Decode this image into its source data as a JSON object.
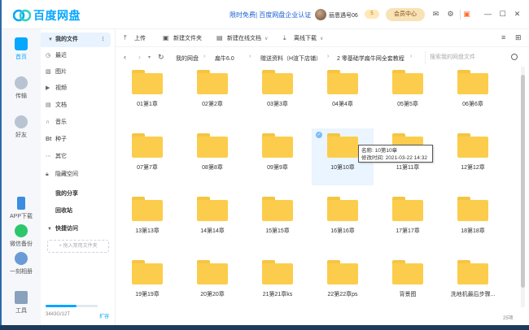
{
  "app": {
    "name": "百度网盘",
    "promo": "限时免费| 百度网盘企业认证",
    "username": "丽恩遇号06",
    "level_badge": "5",
    "vip_badge": "v",
    "member_center": "会员中心",
    "accent": "#06a7ff"
  },
  "nav": [
    {
      "label": "首页",
      "icon": "home-icon"
    },
    {
      "label": "传输",
      "icon": "transfer-icon"
    },
    {
      "label": "好友",
      "icon": "friends-icon"
    },
    {
      "label": "APP下载",
      "icon": "phone-icon"
    },
    {
      "label": "微信备份",
      "icon": "wechat-icon"
    },
    {
      "label": "一刻相册",
      "icon": "album-icon"
    },
    {
      "label": "工具",
      "icon": "tools-icon"
    }
  ],
  "sidebar": {
    "my_files": "我的文件",
    "items": [
      {
        "label": "最近",
        "icon": "clock-icon"
      },
      {
        "label": "图片",
        "icon": "image-icon"
      },
      {
        "label": "视频",
        "icon": "video-icon"
      },
      {
        "label": "文档",
        "icon": "document-icon"
      },
      {
        "label": "音乐",
        "icon": "headphones-icon"
      },
      {
        "label": "种子",
        "icon": "bt-icon"
      },
      {
        "label": "其它",
        "icon": "more-icon"
      },
      {
        "label": "隐藏空间",
        "icon": "lock-icon"
      }
    ],
    "my_share": "我的分享",
    "recycle": "回收站",
    "quick_access": "快捷访问",
    "add_quick": "+ 拖入常用文件夹",
    "quota": "3443G/12T",
    "expand": "扩容"
  },
  "toolbar": {
    "upload": "上传",
    "new_folder": "新建文件夹",
    "new_online_doc": "新建在线文档",
    "offline_download": "离线下载"
  },
  "path": {
    "crumbs": [
      "我的网盘",
      "扁牛6.0",
      "赠送资料（H渲下店铺）",
      "2 零基础学扁牛网全套教程"
    ],
    "search_placeholder": "搜索我的网盘文件"
  },
  "files": [
    "01第1章",
    "02第2章",
    "03第3章",
    "04第4章",
    "05第5章",
    "06第6章",
    "07第7章",
    "08第8章",
    "09第9章",
    "10第10章",
    "11第11章",
    "12第12章",
    "13第13章",
    "14第14章",
    "15第15章",
    "16第16章",
    "17第17章",
    "18第18章",
    "19第19章",
    "20第20章",
    "21第21章ks",
    "22第22章ps",
    "背景图",
    "洗地机最后步骤..."
  ],
  "tooltip": {
    "name": "名称: 10第10章",
    "modified": "修改时间: 2021-03-22  14:32"
  },
  "item_count": "25项"
}
